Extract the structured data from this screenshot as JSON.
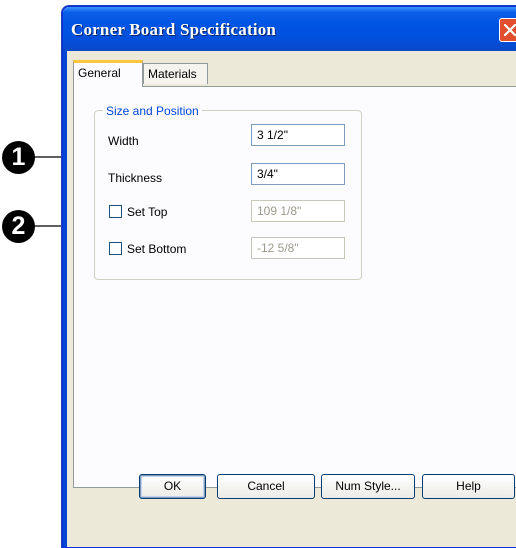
{
  "window": {
    "title": "Corner Board Specification"
  },
  "tabs": [
    {
      "label": "General",
      "active": true
    },
    {
      "label": "Materials",
      "active": false
    }
  ],
  "group": {
    "title": "Size and Position",
    "width_label": "Width",
    "width_value": "3 1/2\"",
    "thickness_label": "Thickness",
    "thickness_value": "3/4\"",
    "set_top_label": "Set Top",
    "set_top_checked": false,
    "set_top_value": "109 1/8\"",
    "set_bottom_label": "Set Bottom",
    "set_bottom_checked": false,
    "set_bottom_value": "-12 5/8\""
  },
  "buttons": {
    "ok": "OK",
    "cancel": "Cancel",
    "num_style": "Num Style...",
    "help": "Help"
  },
  "callouts": [
    "1",
    "2"
  ],
  "colors": {
    "title_bar": "#0054e3",
    "group_title": "#0046d5",
    "tab_highlight": "#ffc83c",
    "close_button": "#e24f2f"
  }
}
